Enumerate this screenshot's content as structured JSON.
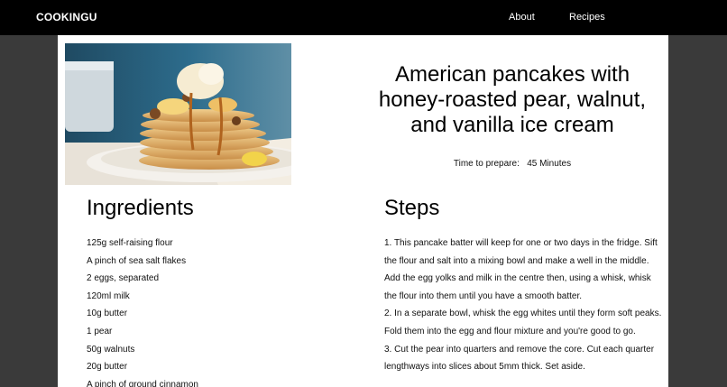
{
  "nav": {
    "brand": "COOKINGU",
    "links": [
      "About",
      "Recipes"
    ]
  },
  "recipe": {
    "title": "American pancakes with honey-roasted pear, walnut, and vanilla ice cream",
    "prep_label": "Time to prepare:",
    "prep_value": "45 Minutes",
    "ingredients_heading": "Ingredients",
    "steps_heading": "Steps",
    "ingredients": [
      "125g self-raising flour",
      "A pinch of sea salt flakes",
      "2 eggs, separated",
      "120ml milk",
      "10g butter",
      "1 pear",
      "50g walnuts",
      "20g butter",
      "A pinch of ground cinnamon"
    ],
    "steps_text": "1. This pancake batter will keep for one or two days in the fridge. Sift the flour and salt into a mixing bowl and make a well in the middle. Add the egg yolks and milk in the centre then, using a whisk, whisk the flour into them until you have a smooth batter.\n2.  In a separate bowl, whisk the egg whites until they form soft peaks. Fold them into the egg and flour mixture and you're good to go.\n3. Cut the pear into quarters and remove the core. Cut each quarter lengthways into slices about 5mm thick. Set aside."
  },
  "colors": {
    "navbar": "#000000",
    "background": "#3a3a3a",
    "card": "#ffffff"
  }
}
